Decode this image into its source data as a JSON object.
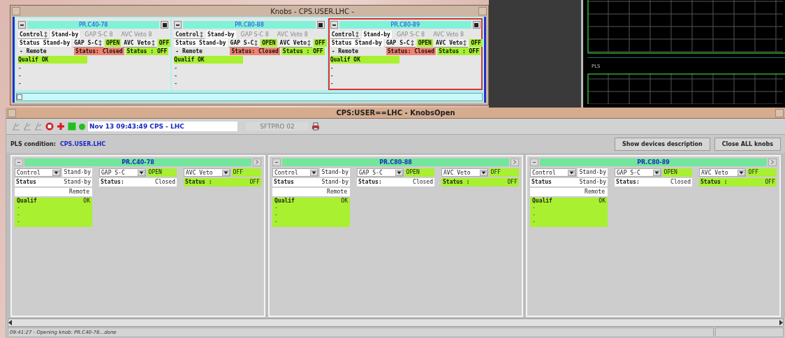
{
  "top_window": {
    "title": "Knobs - CPS.USER.LHC -",
    "knobs": [
      {
        "name": "PR.C40-78",
        "selected": false,
        "control": {
          "label": "Control",
          "value": "Stand-by"
        },
        "columns": [
          "GAP S-C 8",
          "AVC Veto 8"
        ],
        "status": "Status Stand-by",
        "selectors": [
          {
            "label": "GAP S-C",
            "value": "OPEN",
            "color": "#a8f030"
          },
          {
            "label": "AVC Veto",
            "value": "OFF",
            "color": "#a8f030"
          }
        ],
        "mode": "- Remote",
        "statuses": [
          {
            "text": "Status: Closed",
            "color": "#f08272"
          },
          {
            "text": "Status : OFF",
            "color": "#a8f030"
          }
        ],
        "qualif": "Qualif OK",
        "lines": [
          "-",
          "-",
          "-"
        ]
      },
      {
        "name": "PR.C80-88",
        "selected": false,
        "control": {
          "label": "Control",
          "value": "Stand-by"
        },
        "columns": [
          "GAP S-C 8",
          "AVC Veto 8"
        ],
        "status": "Status Stand-by",
        "selectors": [
          {
            "label": "GAP S-C",
            "value": "OPEN",
            "color": "#a8f030"
          },
          {
            "label": "AVC Veto",
            "value": "OFF",
            "color": "#a8f030"
          }
        ],
        "mode": "- Remote",
        "statuses": [
          {
            "text": "Status: Closed",
            "color": "#f08272"
          },
          {
            "text": "Status : OFF",
            "color": "#a8f030"
          }
        ],
        "qualif": "Qualif OK",
        "lines": [
          "-",
          "-",
          "-"
        ]
      },
      {
        "name": "PR.C80-89",
        "selected": true,
        "control": {
          "label": "Control",
          "value": "Stand-by"
        },
        "columns": [
          "GAP S-C 8",
          "AVC Veto 8"
        ],
        "status": "Status Stand-by",
        "selectors": [
          {
            "label": "GAP S-C",
            "value": "OPEN",
            "color": "#a8f030"
          },
          {
            "label": "AVC Veto",
            "value": "OFF",
            "color": "#a8f030"
          }
        ],
        "mode": "- Remote",
        "statuses": [
          {
            "text": "Status: Closed",
            "color": "#f08272"
          },
          {
            "text": "Status : OFF",
            "color": "#a8f030"
          }
        ],
        "qualif": "Qualif OK",
        "lines": [
          "-",
          "-",
          "-"
        ]
      }
    ]
  },
  "plot_panel": {
    "label": "PLS"
  },
  "main_window": {
    "title": "CPS:USER==LHC - KnobsOpen",
    "toolbar": {
      "timestamp": "Nov 13 09:43:49  CPS - LHC",
      "user": "SFTPRO 02"
    },
    "condition": {
      "label": "PLS condition:",
      "value": "CPS.USER.LHC"
    },
    "buttons": [
      "Show devices description",
      "Close ALL knobs"
    ],
    "knobs": [
      {
        "name": "PR.C40-78",
        "selectors": [
          {
            "label": "Control",
            "value": "Stand-by",
            "color": "#ffffff"
          },
          {
            "label": "GAP S-C",
            "value": "OPEN",
            "color": "#a8f030"
          },
          {
            "label": "AVC Veto",
            "value": "OFF",
            "color": "#a8f030"
          }
        ],
        "statuses": [
          {
            "label": "Status",
            "value": "Stand-by",
            "color": "#ffffff"
          },
          {
            "label": "Status:",
            "value": "Closed",
            "color": "#ffffff"
          },
          {
            "label": "Status :",
            "value": "OFF",
            "color": "#a8f030"
          }
        ],
        "mode": "Remote",
        "qualif": {
          "label": "Qualif",
          "value": "OK",
          "lines": [
            "-",
            "-",
            "-"
          ]
        }
      },
      {
        "name": "PR.C80-88",
        "selectors": [
          {
            "label": "Control",
            "value": "Stand-by",
            "color": "#ffffff"
          },
          {
            "label": "GAP S-C",
            "value": "OPEN",
            "color": "#a8f030"
          },
          {
            "label": "AVC Veto",
            "value": "OFF",
            "color": "#a8f030"
          }
        ],
        "statuses": [
          {
            "label": "Status",
            "value": "Stand-by",
            "color": "#ffffff"
          },
          {
            "label": "Status:",
            "value": "Closed",
            "color": "#ffffff"
          },
          {
            "label": "Status :",
            "value": "OFF",
            "color": "#a8f030"
          }
        ],
        "mode": "Remote",
        "qualif": {
          "label": "Qualif",
          "value": "OK",
          "lines": [
            "-",
            "-",
            "-"
          ]
        }
      },
      {
        "name": "PR.C80-89",
        "selectors": [
          {
            "label": "Control",
            "value": "Stand-by",
            "color": "#ffffff"
          },
          {
            "label": "GAP S-C",
            "value": "OPEN",
            "color": "#a8f030"
          },
          {
            "label": "AVC Veto",
            "value": "OFF",
            "color": "#a8f030"
          }
        ],
        "statuses": [
          {
            "label": "Status",
            "value": "Stand-by",
            "color": "#ffffff"
          },
          {
            "label": "Status:",
            "value": "Closed",
            "color": "#ffffff"
          },
          {
            "label": "Status :",
            "value": "OFF",
            "color": "#a8f030"
          }
        ],
        "mode": "Remote",
        "qualif": {
          "label": "Qualif",
          "value": "OK",
          "lines": [
            "-",
            "-",
            "-"
          ]
        }
      }
    ],
    "status_bar": "09:41:27 - Opening knob: PR.C40-78...done"
  }
}
